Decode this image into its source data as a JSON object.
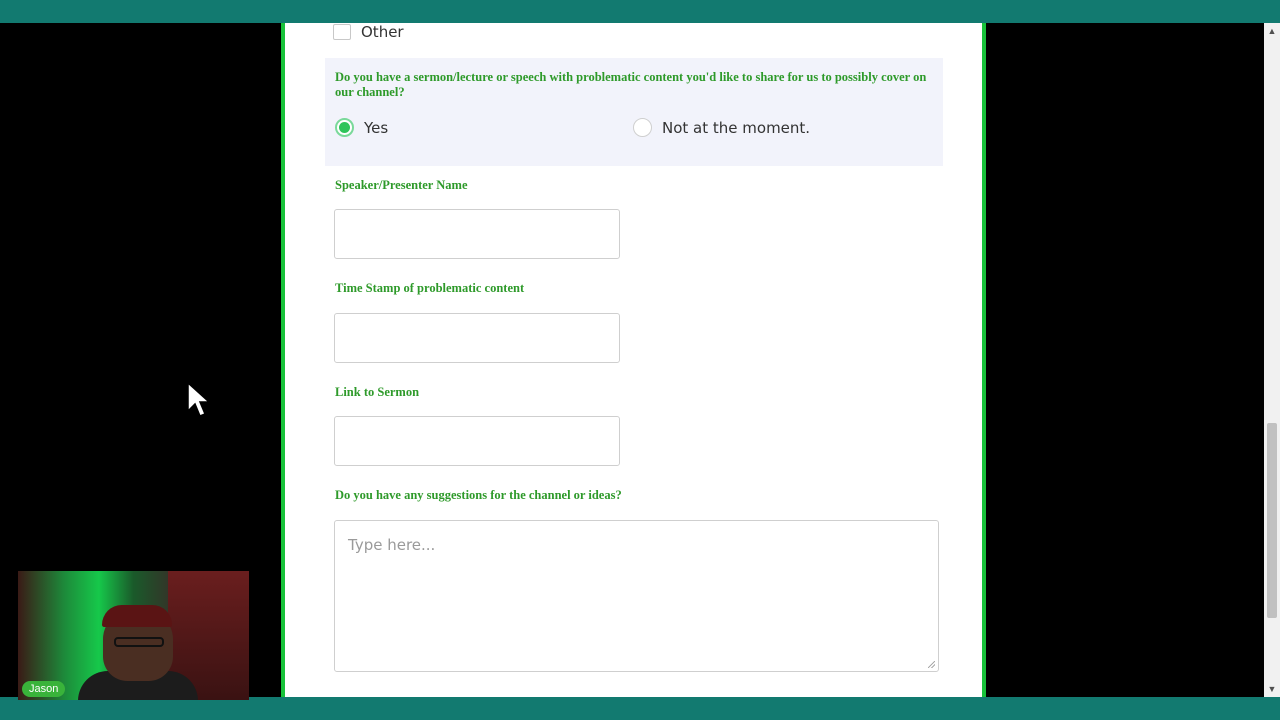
{
  "form": {
    "other_checkbox_label": "Other",
    "share_question": {
      "label": "Do you have a sermon/lecture or speech with problematic content you'd like to share for us to possibly cover on our channel?",
      "options": [
        {
          "label": "Yes",
          "selected": true
        },
        {
          "label": "Not at the moment.",
          "selected": false
        }
      ]
    },
    "speaker_name_label": "Speaker/Presenter Name",
    "timestamp_label": "Time Stamp of problematic content",
    "link_label": "Link to Sermon",
    "suggestions_label": "Do you have any suggestions for the channel or ideas?",
    "suggestions_placeholder": "Type here..."
  },
  "webcam": {
    "name_tag": "Jason"
  },
  "colors": {
    "frame_teal": "#127a70",
    "panel_border_green": "#18c23a",
    "label_green": "#2e9a2a",
    "radio_selected_green": "#2ec45a",
    "question_bg": "#f2f3fb"
  },
  "icons": {
    "cursor": "mouse-pointer-icon",
    "scroll_up": "scroll-up-arrow-icon",
    "scroll_down": "scroll-down-arrow-icon"
  }
}
